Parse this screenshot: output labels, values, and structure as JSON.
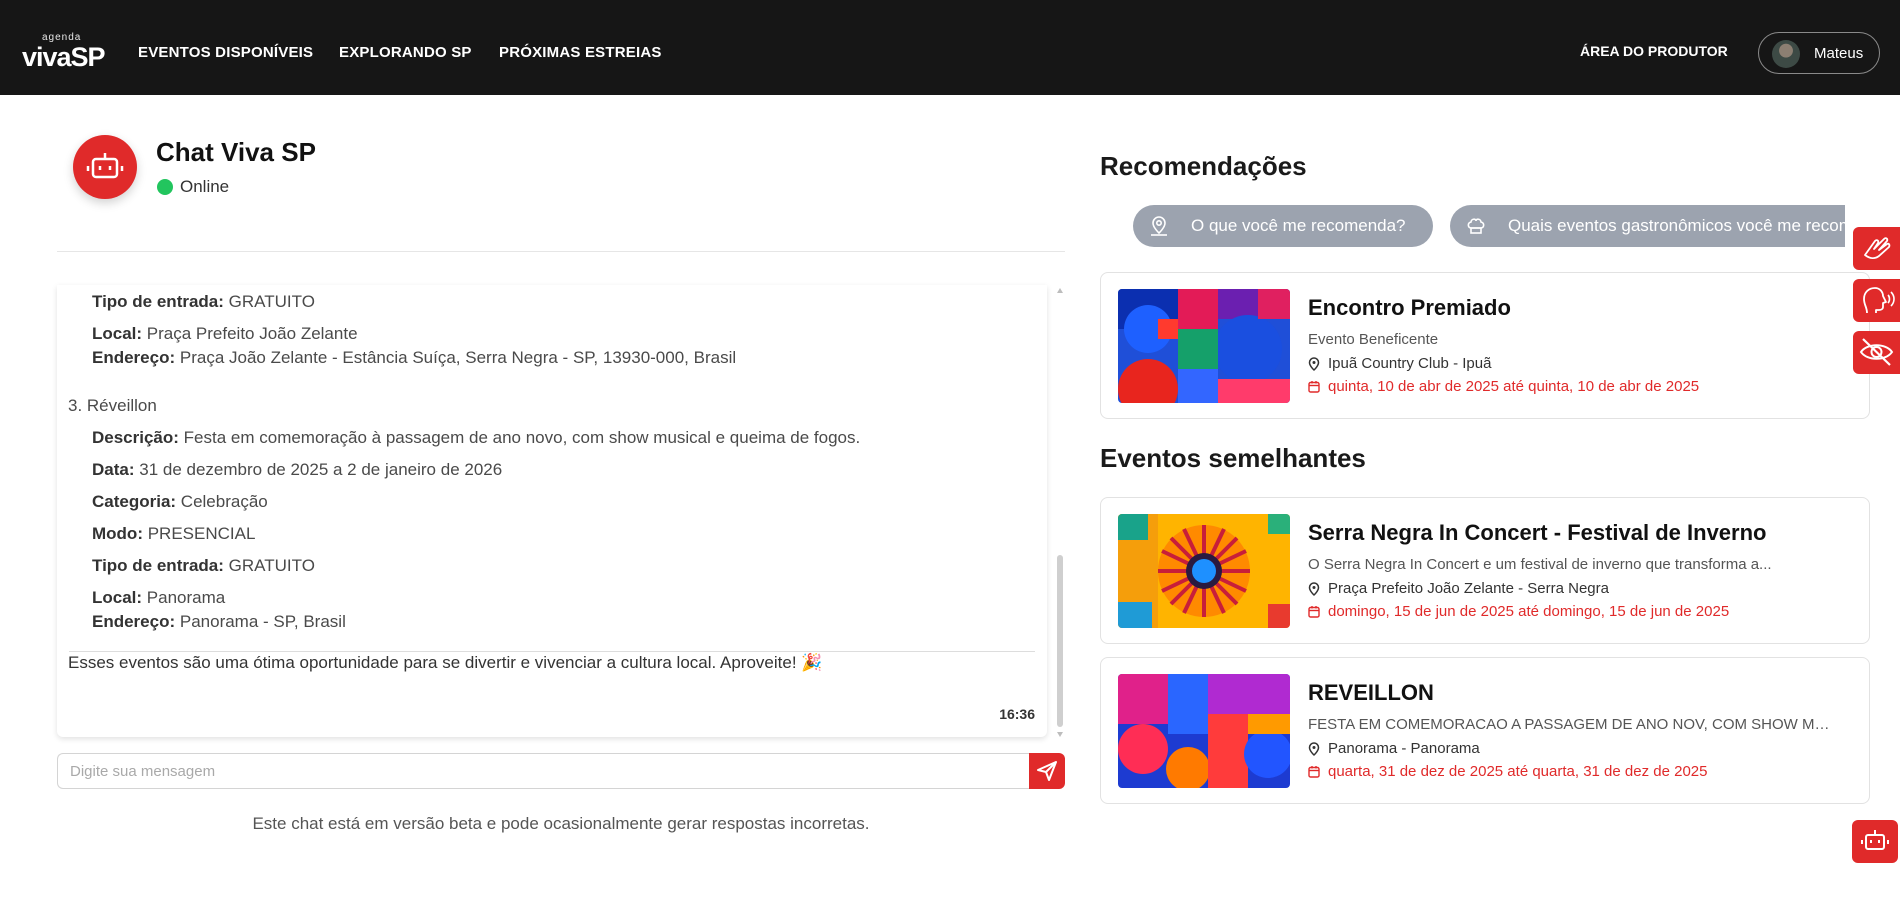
{
  "nav": {
    "logo_small": "agenda",
    "logo_big": "vivaSP",
    "links": [
      "EVENTOS DISPONÍVEIS",
      "EXPLORANDO SP",
      "PRÓXIMAS ESTREIAS"
    ],
    "producer_area": "ÁREA DO PRODUTOR",
    "user_name": "Mateus"
  },
  "chat": {
    "title": "Chat Viva SP",
    "status": "Online",
    "status_color": "#22c55e",
    "input_placeholder": "Digite sua mensagem",
    "beta_note": "Este chat está em versão beta e pode ocasionalmente gerar respostas incorretas.",
    "message": {
      "lines": [
        {
          "label": "Tipo de entrada:",
          "value": " GRATUITO"
        },
        {
          "label": "Local:",
          "value": " Praça Prefeito João Zelante"
        },
        {
          "label": "Endereço:",
          "value": " Praça João Zelante - Estância Suíça, Serra Negra - SP, 13930-000, Brasil"
        },
        {
          "label": "",
          "value": "3. Réveillon"
        },
        {
          "label": "Descrição:",
          "value": " Festa em comemoração à passagem de ano novo, com show musical e queima de fogos."
        },
        {
          "label": "Data:",
          "value": " 31 de dezembro de 2025 a 2 de janeiro de 2026"
        },
        {
          "label": "Categoria:",
          "value": " Celebração"
        },
        {
          "label": "Modo:",
          "value": " PRESENCIAL"
        },
        {
          "label": "Tipo de entrada:",
          "value": " GRATUITO"
        },
        {
          "label": "Local:",
          "value": " Panorama"
        },
        {
          "label": "Endereço:",
          "value": " Panorama - SP, Brasil"
        }
      ],
      "closing": "Esses eventos são uma ótima oportunidade para se divertir e vivenciar a cultura local. Aproveite! 🎉",
      "time": "16:36"
    }
  },
  "recommendations": {
    "title": "Recomendações",
    "chips": [
      "O que você me recomenda?",
      "Quais eventos gastronômicos você me recomenda?"
    ],
    "event": {
      "name": "Encontro Premiado",
      "desc": "Evento Beneficente",
      "location": "Ipuã Country Club - Ipuã",
      "date": "quinta, 10 de abr de 2025 até quinta, 10 de abr de 2025"
    }
  },
  "similar": {
    "title": "Eventos semelhantes",
    "events": [
      {
        "name": "Serra Negra In Concert - Festival de Inverno",
        "desc": "O Serra Negra In Concert e um festival de inverno que transforma a...",
        "location": "Praça Prefeito João Zelante - Serra Negra",
        "date": "domingo, 15 de jun de 2025 até domingo, 15 de jun de 2025"
      },
      {
        "name": "REVEILLON",
        "desc": "FESTA EM COMEMORACAO A PASSAGEM DE ANO NOV, COM SHOW MUSICAL E...",
        "location": "Panorama - Panorama",
        "date": "quarta, 31 de dez de 2025 até quarta, 31 de dez de 2025"
      }
    ]
  },
  "colors": {
    "brand_red": "#e02a2a",
    "navbar_bg": "#161616",
    "chip_bg": "#9ca3af"
  }
}
